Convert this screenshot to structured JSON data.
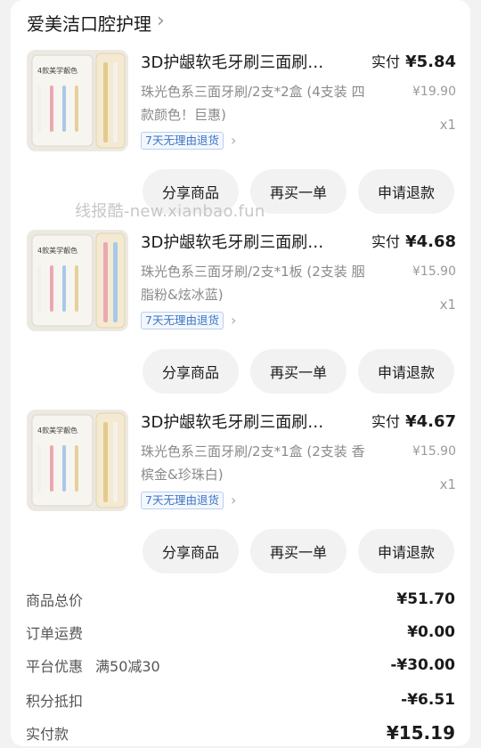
{
  "shop": {
    "name": "爱美洁口腔护理",
    "chevron": "›"
  },
  "watermark": "线报酷-new.xianbao.fun",
  "common": {
    "paid_label": "实付",
    "badge": "7天无理由退货",
    "badge_chevron": "›",
    "btn_share": "分享商品",
    "btn_rebuy": "再买一单",
    "btn_refund": "申请退款"
  },
  "items": [
    {
      "title": "3D护龈软毛牙刷三面刷…",
      "paid_price": "¥5.84",
      "sku": "珠光色系三面牙刷/2支*2盒 (4支装 四款颜色！巨惠)",
      "orig_price": "¥19.90",
      "qty": "x1",
      "thumb_text": "4款美学靓色"
    },
    {
      "title": "3D护龈软毛牙刷三面刷…",
      "paid_price": "¥4.68",
      "sku": "珠光色系三面牙刷/2支*1板 (2支装 胭脂粉&炫冰蓝)",
      "orig_price": "¥15.90",
      "qty": "x1",
      "thumb_text": "4款美学靓色"
    },
    {
      "title": "3D护龈软毛牙刷三面刷…",
      "paid_price": "¥4.67",
      "sku": "珠光色系三面牙刷/2支*1盒 (2支装 香槟金&珍珠白)",
      "orig_price": "¥15.90",
      "qty": "x1",
      "thumb_text": "4款美学靓色"
    }
  ],
  "summary": {
    "goods_total_label": "商品总价",
    "goods_total": "¥51.70",
    "shipping_label": "订单运费",
    "shipping": "¥0.00",
    "platform_label": "平台优惠",
    "platform_note": "满50减30",
    "platform": "-¥30.00",
    "points_label": "积分抵扣",
    "points": "-¥6.51",
    "paid_label": "实付款",
    "paid": "¥15.19"
  }
}
